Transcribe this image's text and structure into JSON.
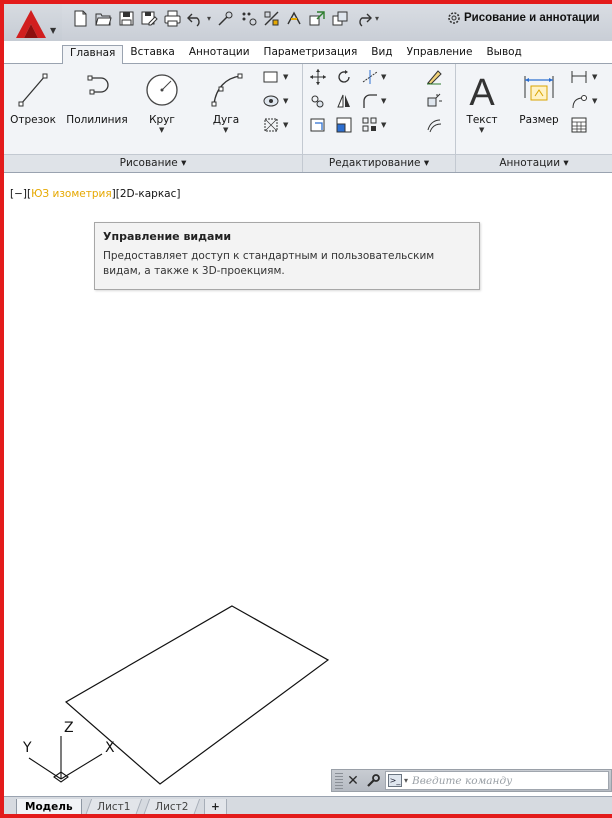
{
  "qat": {
    "icons": [
      "new-icon",
      "open-icon",
      "save-icon",
      "save-as-icon",
      "print-icon",
      "undo-icon",
      "redo-icon",
      "match-properties-icon",
      "wblock-icon",
      "plot-icon",
      "publish-icon",
      "share-icon"
    ],
    "workspace_label": "Рисование и аннотации"
  },
  "tabs": [
    "Главная",
    "Вставка",
    "Аннотации",
    "Параметризация",
    "Вид",
    "Управление",
    "Вывод"
  ],
  "active_tab": "Главная",
  "ribbon": {
    "drawing": {
      "title": "Рисование",
      "tools": [
        "Отрезок",
        "Полилиния",
        "Круг",
        "Дуга"
      ]
    },
    "editing": {
      "title": "Редактирование"
    },
    "annotations": {
      "title": "Аннотации",
      "tools": [
        "Текст",
        "Размер"
      ]
    }
  },
  "viewport": {
    "label_prefix": "[−][",
    "label_view": "ЮЗ изометрия",
    "label_suffix": "][2D-каркас]",
    "tooltip": {
      "title": "Управление видами",
      "body": "Предоставляет доступ к стандартным и пользовательским видам, а также к 3D-проекциям."
    },
    "ucs": {
      "x": "X",
      "y": "Y",
      "z": "Z"
    }
  },
  "cmdline": {
    "placeholder": "Введите команду"
  },
  "layout_tabs": {
    "model": "Модель",
    "sheet1": "Лист1",
    "sheet2": "Лист2",
    "add": "+"
  },
  "colors": {
    "frame": "#e31b1b",
    "iso_view": "#e6a800",
    "app_logo": "#d11f1f"
  }
}
